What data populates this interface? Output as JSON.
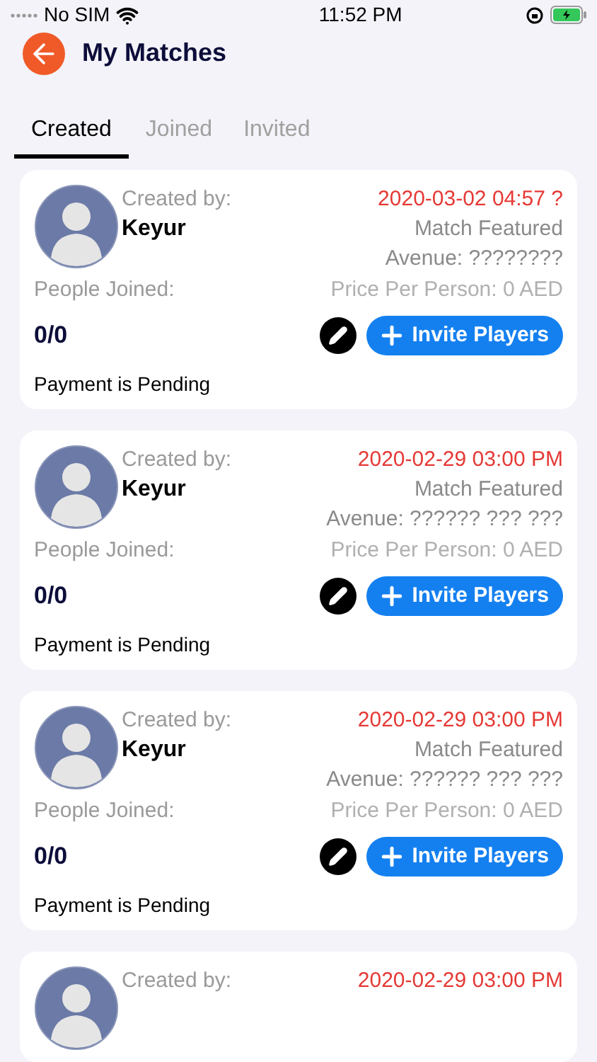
{
  "status_bar": {
    "carrier": "No SIM",
    "time": "11:52 PM"
  },
  "header": {
    "title": "My Matches"
  },
  "tabs": [
    {
      "label": "Created",
      "selected": true
    },
    {
      "label": "Joined",
      "selected": false
    },
    {
      "label": "Invited",
      "selected": false
    }
  ],
  "matches": [
    {
      "created_label": "Created by:",
      "name": "Keyur",
      "date": "2020-03-02 04:57 ?",
      "title": "Match Featured",
      "avenue": "Avenue: ????????",
      "people_label": "People Joined:",
      "price": "Price Per Person: 0 AED",
      "count": "0/0",
      "invite_label": "Invite Players",
      "payment": "Payment is Pending"
    },
    {
      "created_label": "Created by:",
      "name": "Keyur",
      "date": "2020-02-29 03:00 PM",
      "title": "Match Featured",
      "avenue": "Avenue: ?????? ??? ???",
      "people_label": "People Joined:",
      "price": "Price Per Person: 0 AED",
      "count": "0/0",
      "invite_label": "Invite Players",
      "payment": "Payment is Pending"
    },
    {
      "created_label": "Created by:",
      "name": "Keyur",
      "date": "2020-02-29 03:00 PM",
      "title": "Match Featured",
      "avenue": "Avenue: ?????? ??? ???",
      "people_label": "People Joined:",
      "price": "Price Per Person: 0 AED",
      "count": "0/0",
      "invite_label": "Invite Players",
      "payment": "Payment is Pending"
    },
    {
      "created_label": "Created by:",
      "date": "2020-02-29 03:00 PM"
    }
  ]
}
